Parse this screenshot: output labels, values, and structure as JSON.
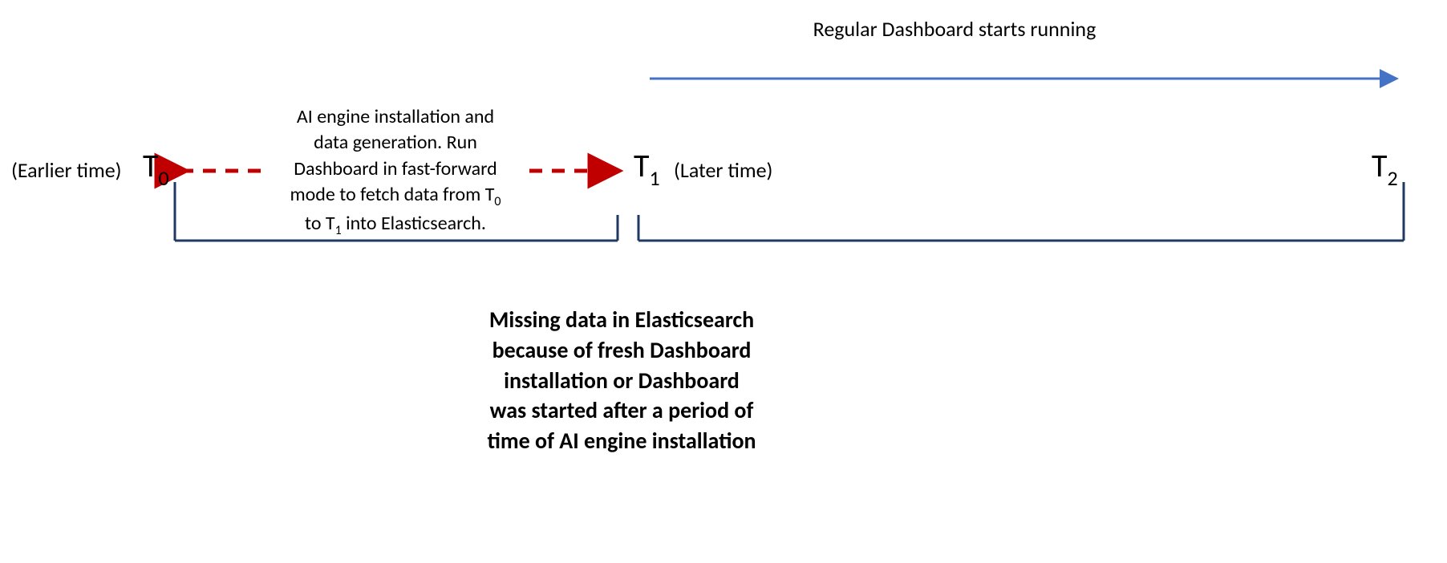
{
  "labels": {
    "earlier": "(Earlier time)",
    "later": "(Later time)",
    "t0_main": "T",
    "t0_sub": "0",
    "t1_main": "T",
    "t1_sub": "1",
    "t2_main": "T",
    "t2_sub": "2"
  },
  "top_caption": "Regular Dashboard starts running",
  "center_caption_l1": "AI engine installation and",
  "center_caption_l2": "data generation. Run",
  "center_caption_l3": "Dashboard in fast-forward",
  "center_caption_l4a": "mode to fetch data from T",
  "center_caption_l4b": "0",
  "center_caption_l5a": "to T",
  "center_caption_l5b": "1",
  "center_caption_l5c": " into Elasticsearch.",
  "bottom_caption_l1": "Missing data in Elasticsearch",
  "bottom_caption_l2": "because of fresh Dashboard",
  "bottom_caption_l3": "installation or Dashboard",
  "bottom_caption_l4": "was started after a period of",
  "bottom_caption_l5": "time of AI engine installation",
  "colors": {
    "timeline": "#1f3864",
    "dashed_arrow": "#c00000",
    "blue_arrow": "#4472c4"
  }
}
